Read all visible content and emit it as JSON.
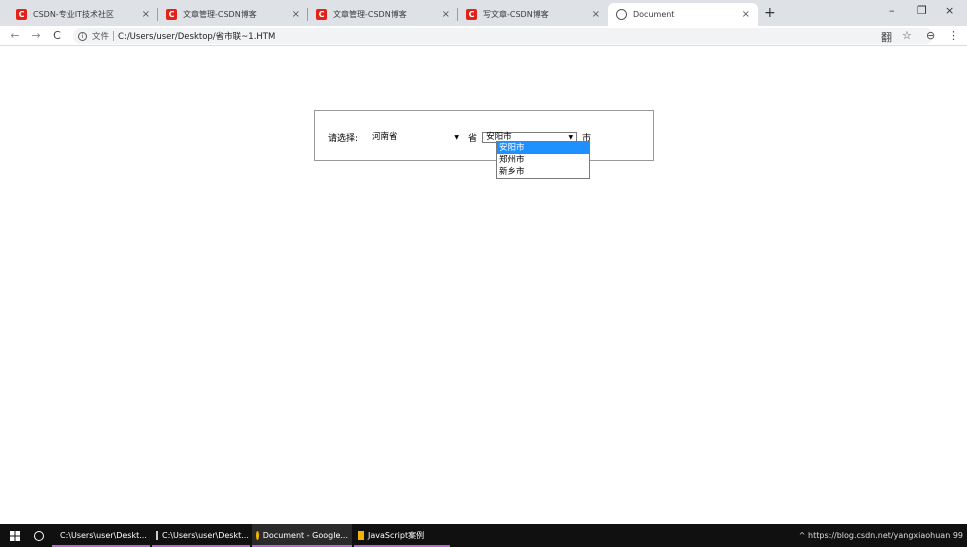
{
  "browser": {
    "tabs": [
      {
        "title": "CSDN-专业IT技术社区",
        "favicon": "csdn-icon"
      },
      {
        "title": "文章管理-CSDN博客",
        "favicon": "csdn-icon"
      },
      {
        "title": "文章管理-CSDN博客",
        "favicon": "csdn-icon"
      },
      {
        "title": "写文章-CSDN博客",
        "favicon": "csdn-icon"
      },
      {
        "title": "Document",
        "favicon": "globe-icon",
        "active": true
      }
    ],
    "new_tab": "+",
    "close_glyph": "×",
    "window_controls": {
      "minimize": "–",
      "maximize": "❐",
      "close": "×"
    },
    "nav": {
      "back": "←",
      "forward": "→",
      "reload": "C"
    },
    "address": {
      "scheme_label": "文件",
      "url": "C:/Users/user/Desktop/省市联~1.HTM"
    },
    "toolbar_icons": {
      "translate": "翻",
      "bookmark": "☆",
      "account": "⊖",
      "menu": "⋮"
    }
  },
  "form": {
    "prompt": "请选择:",
    "province_selected": "河南省",
    "province_unit": "省",
    "city_selected": "安阳市",
    "city_unit": "市",
    "city_options": [
      "安阳市",
      "郑州市",
      "新乡市"
    ],
    "highlight_index": 0
  },
  "taskbar": {
    "items": [
      {
        "label": "C:\\Users\\user\\Deskt...",
        "icon": "folder-icon"
      },
      {
        "label": "C:\\Users\\user\\Deskt...",
        "icon": "terminal-icon"
      },
      {
        "label": "Document - Google...",
        "icon": "chrome-icon",
        "active": true
      },
      {
        "label": "JavaScript案例",
        "icon": "bookmark-icon"
      }
    ],
    "tray_text": "^ https://blog.csdn.net/yangxiaohuan 99"
  },
  "colors": {
    "accent": "#1e90ff",
    "csdn": "#e2231a"
  }
}
